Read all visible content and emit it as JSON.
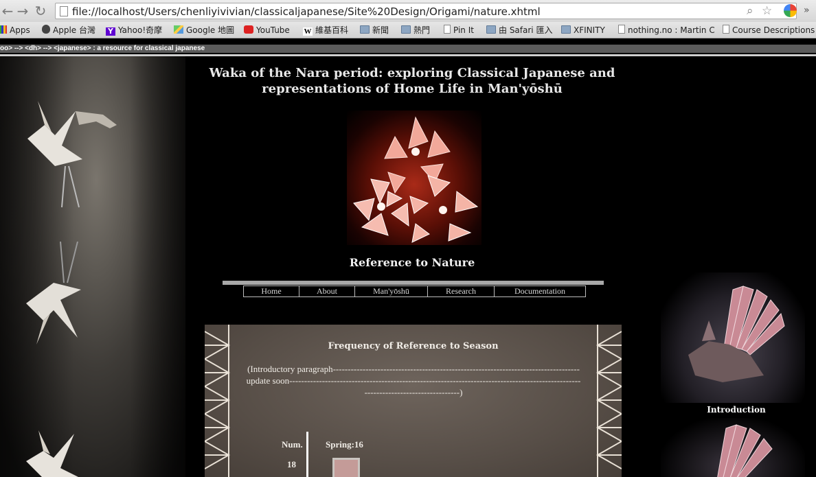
{
  "browser": {
    "url": "file://localhost/Users/chenliyivivian/classicaljapanese/Site%20Design/Origami/nature.xhtml",
    "bookmarks": [
      {
        "label": "Apps",
        "icon": "apps-grid-icon"
      },
      {
        "label": "Apple 台灣",
        "icon": "apple-icon"
      },
      {
        "label": "Yahoo!奇摩",
        "icon": "yahoo-icon"
      },
      {
        "label": "Google 地圖",
        "icon": "google-maps-icon"
      },
      {
        "label": "YouTube",
        "icon": "youtube-icon"
      },
      {
        "label": "維基百科",
        "icon": "wikipedia-icon"
      },
      {
        "label": "新聞",
        "icon": "folder-icon"
      },
      {
        "label": "熱門",
        "icon": "folder-icon"
      },
      {
        "label": "Pin It",
        "icon": "page-icon"
      },
      {
        "label": "由 Safari 匯入",
        "icon": "folder-icon"
      },
      {
        "label": "XFINITY",
        "icon": "folder-icon"
      },
      {
        "label": "nothing.no : Martin C",
        "icon": "page-icon"
      },
      {
        "label": "Course Descriptions",
        "icon": "page-icon"
      }
    ]
  },
  "page": {
    "topbar_text": "oo> --> <dh> --> <japanese> : a resource for classical japanese",
    "site_title": "Waka of the Nara period: exploring Classical Japanese and representations of Home Life in Man'yōshū",
    "section_title": "Reference to Nature",
    "nav": [
      "Home",
      "About",
      "Man'yōshū",
      "Research",
      "Documentation"
    ],
    "content": {
      "heading": "Frequency of Reference to Season",
      "intro": "(Introductory paragraph-----------------------------------------------------------------------------------update soon----------------------------------------------------------------------------------------------------------------------------------)",
      "num_label": "Num.",
      "num_value": "18",
      "season_label": "Spring:16"
    },
    "right_caption": "Introduction"
  },
  "chart_data": {
    "type": "bar",
    "categories": [
      "Spring"
    ],
    "values": [
      16
    ],
    "title": "Frequency of Reference to Season",
    "ylabel": "Num."
  }
}
